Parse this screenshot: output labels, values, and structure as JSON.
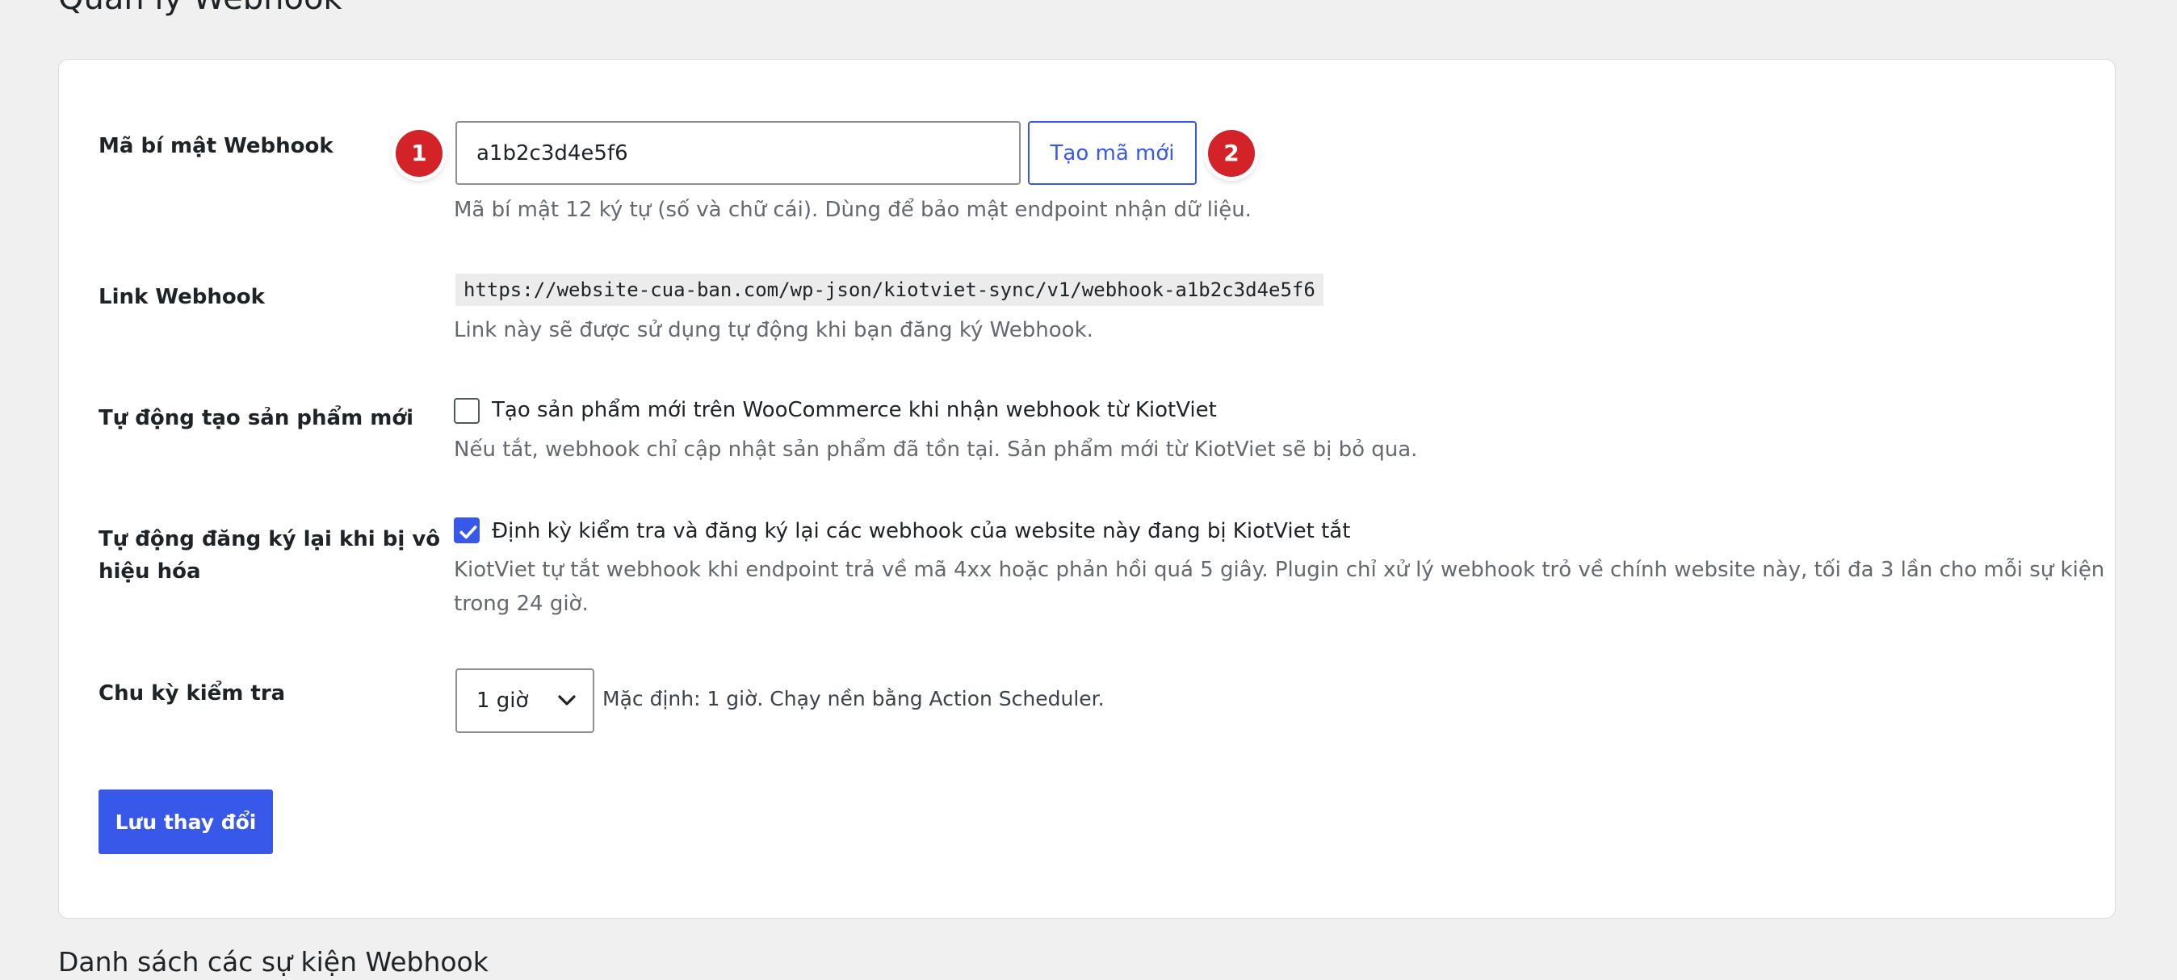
{
  "page": {
    "title": "Quản lý Webhook"
  },
  "secret": {
    "label": "Mã bí mật Webhook",
    "value": "a1b2c3d4e5f6",
    "generate_button": "Tạo mã mới",
    "description": "Mã bí mật 12 ký tự (số và chữ cái). Dùng để bảo mật endpoint nhận dữ liệu."
  },
  "link": {
    "label": "Link Webhook",
    "url": "https://website-cua-ban.com/wp-json/kiotviet-sync/v1/webhook-a1b2c3d4e5f6",
    "description": "Link này sẽ được sử dụng tự động khi bạn đăng ký Webhook."
  },
  "auto_create": {
    "label": "Tự động tạo sản phẩm mới",
    "checked": false,
    "checkbox_label": "Tạo sản phẩm mới trên WooCommerce khi nhận webhook từ KiotViet",
    "description": "Nếu tắt, webhook chỉ cập nhật sản phẩm đã tồn tại. Sản phẩm mới từ KiotViet sẽ bị bỏ qua."
  },
  "auto_reregister": {
    "label_line1": "Tự động đăng ký lại khi bị vô",
    "label_line2": "hiệu hóa",
    "checked": true,
    "checkbox_label": "Định kỳ kiểm tra và đăng ký lại các webhook của website này đang bị KiotViet tắt",
    "description_line1": "KiotViet tự tắt webhook khi endpoint trả về mã 4xx hoặc phản hồi quá 5 giây. Plugin chỉ xử lý webhook trỏ về chính website này, tối đa 3 lần cho mỗi sự kiện",
    "description_line2": "trong 24 giờ."
  },
  "interval": {
    "label": "Chu kỳ kiểm tra",
    "selected": "1 giờ",
    "description": "Mặc định: 1 giờ. Chạy nền bằng Action Scheduler."
  },
  "actions": {
    "save_label": "Lưu thay đổi"
  },
  "events_section": {
    "title": "Danh sách các sự kiện Webhook"
  },
  "markers": [
    "1",
    "2"
  ],
  "colors": {
    "accent": "#3858e9",
    "marker": "#d32228",
    "background": "#f0f0f1"
  },
  "icons": {
    "select_arrow": "chevron-down-icon",
    "checkbox_checked": "checkmark-icon"
  }
}
